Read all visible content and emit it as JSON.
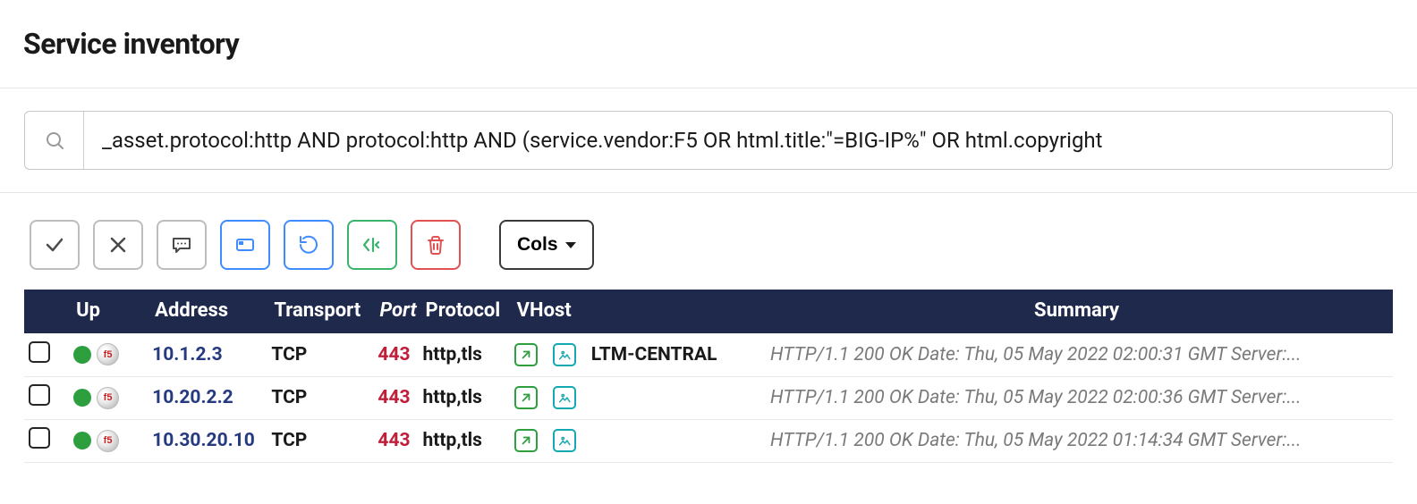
{
  "header": {
    "title": "Service inventory"
  },
  "search": {
    "value": "_asset.protocol:http AND protocol:http AND (service.vendor:F5 OR html.title:\"=BIG-IP%\" OR html.copyright"
  },
  "toolbar": {
    "cols_label": "Cols"
  },
  "columns": {
    "up": "Up",
    "address": "Address",
    "transport": "Transport",
    "port": "Port",
    "protocol": "Protocol",
    "vhost": "VHost",
    "summary": "Summary"
  },
  "logo_text": "f5",
  "rows": [
    {
      "address": "10.1.2.3",
      "transport": "TCP",
      "port": "443",
      "protocol": "http,tls",
      "vhost": "LTM-CENTRAL",
      "summary": "HTTP/1.1 200 OK Date: Thu, 05 May 2022 02:00:31 GMT Server:..."
    },
    {
      "address": "10.20.2.2",
      "transport": "TCP",
      "port": "443",
      "protocol": "http,tls",
      "vhost": "",
      "summary": "HTTP/1.1 200 OK Date: Thu, 05 May 2022 02:00:36 GMT Server:..."
    },
    {
      "address": "10.30.20.10",
      "transport": "TCP",
      "port": "443",
      "protocol": "http,tls",
      "vhost": "",
      "summary": "HTTP/1.1 200 OK Date: Thu, 05 May 2022 01:14:34 GMT Server:..."
    }
  ]
}
